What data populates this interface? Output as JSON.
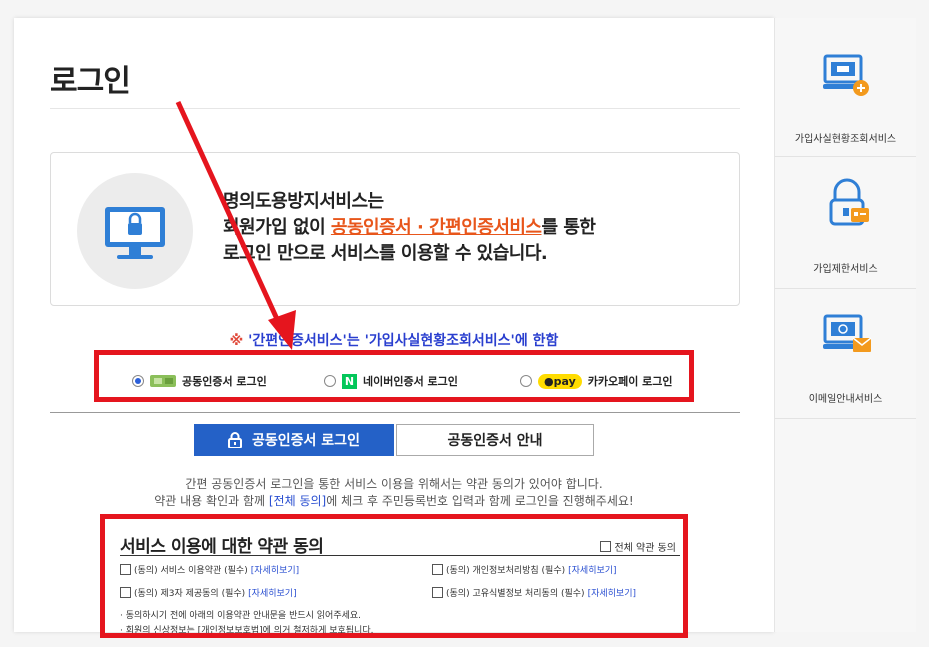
{
  "page": {
    "title": "로그인"
  },
  "info": {
    "line1": "명의도용방지서비스는",
    "line2_pre": "회원가입 없이 ",
    "line2_highlight": "공동인증서 · 간편인증서비스",
    "line2_post": "를 통한",
    "line3": "로그인 만으로 서비스를 이용할 수 있습니다."
  },
  "notice": {
    "mark": "※",
    "text": " '간편인증서비스'는 '가입사실현황조회서비스'에 한함"
  },
  "login_options": [
    {
      "label": "공동인증서 로그인",
      "selected": true,
      "icon": "certificate-icon"
    },
    {
      "label": "네이버인증서 로그인",
      "selected": false,
      "badge": "N",
      "icon": "naver-logo-icon"
    },
    {
      "label": "카카오페이 로그인",
      "selected": false,
      "badge": "pay",
      "icon": "kakaopay-logo-icon"
    }
  ],
  "buttons": {
    "primary": "공동인증서 로그인",
    "secondary": "공동인증서 안내"
  },
  "description": {
    "line1": "간편 공동인증서 로그인을 통한 서비스 이용을 위해서는 약관 동의가 있어야 합니다.",
    "line2_pre": "약관 내용 확인과 함께 ",
    "line2_link": "[전체 동의]",
    "line2_post": "에 체크 후 주민등록번호 입력과 함께 로그인을 진행해주세요!"
  },
  "terms": {
    "title": "서비스 이용에 대한 약관 동의",
    "all_agree": "전체 약관 동의",
    "items": [
      {
        "label": "(동의) 서비스 이용약관 (필수)",
        "link": "[자세히보기]"
      },
      {
        "label": "(동의) 개인정보처리방침 (필수)",
        "link": "[자세히보기]"
      },
      {
        "label": "(동의) 제3자 제공동의 (필수)",
        "link": "[자세히보기]"
      },
      {
        "label": "(동의) 고유식별정보 처리동의 (필수)",
        "link": "[자세히보기]"
      }
    ],
    "bullets": [
      "· 동의하시기 전에 아래의 이용약관 안내문을 반드시 읽어주세요.",
      "· 회원의 신상정보는 [개인정보보호법]에 의거 철저하게 보호됩니다."
    ]
  },
  "sidebar": [
    {
      "label": "가입사실현황조회서비스",
      "icon": "monitor-search-icon"
    },
    {
      "label": "가입제한서비스",
      "icon": "lock-card-icon"
    },
    {
      "label": "이메일안내서비스",
      "icon": "monitor-mail-icon"
    }
  ],
  "colors": {
    "primary": "#2461c7",
    "highlight": "#e8561b",
    "annotation": "#e5151e",
    "link": "#2a4fd1"
  }
}
